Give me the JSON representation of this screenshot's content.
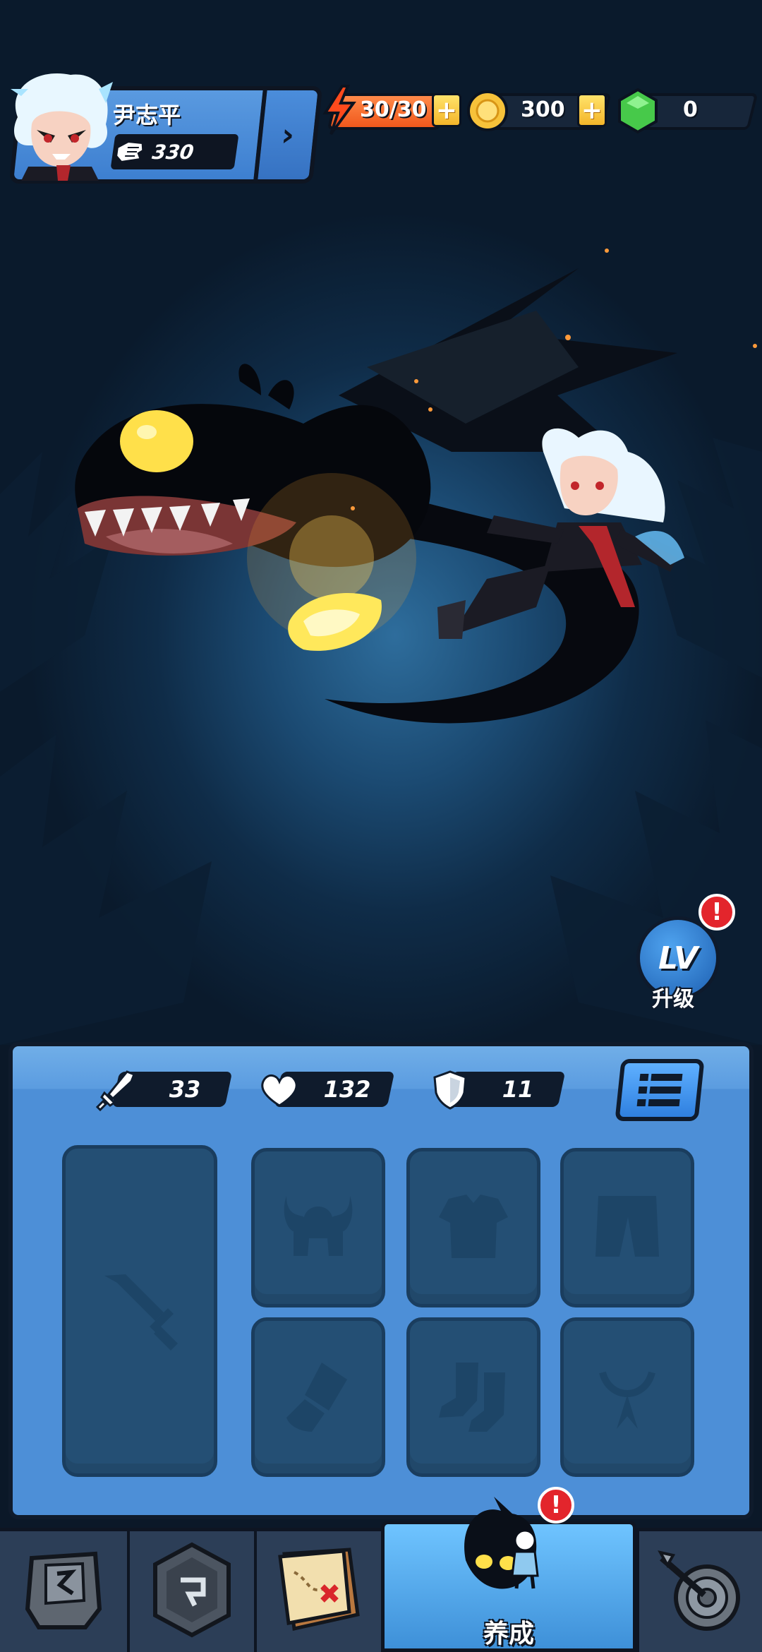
{
  "player": {
    "name": "尹志平",
    "power": "330"
  },
  "resources": {
    "energy": "30/30",
    "gold": "300",
    "gems": "0"
  },
  "level_up": {
    "badge": "LV",
    "label": "升级",
    "alert": "!"
  },
  "stats": {
    "attack": "33",
    "health": "132",
    "defense": "11"
  },
  "equipment_slots": [
    "weapon",
    "helmet",
    "armor",
    "pants",
    "gloves",
    "boots",
    "necklace"
  ],
  "nav": {
    "active_label": "养成",
    "alert": "!",
    "items": [
      "shop",
      "dungeon",
      "map",
      "develop",
      "skills"
    ]
  },
  "colors": {
    "panel": "#4d8fd7",
    "slot": "#244f74",
    "energy": "#ff6a2b",
    "gold": "#f7c23a",
    "gem": "#47c94a",
    "alert": "#e3252c"
  }
}
